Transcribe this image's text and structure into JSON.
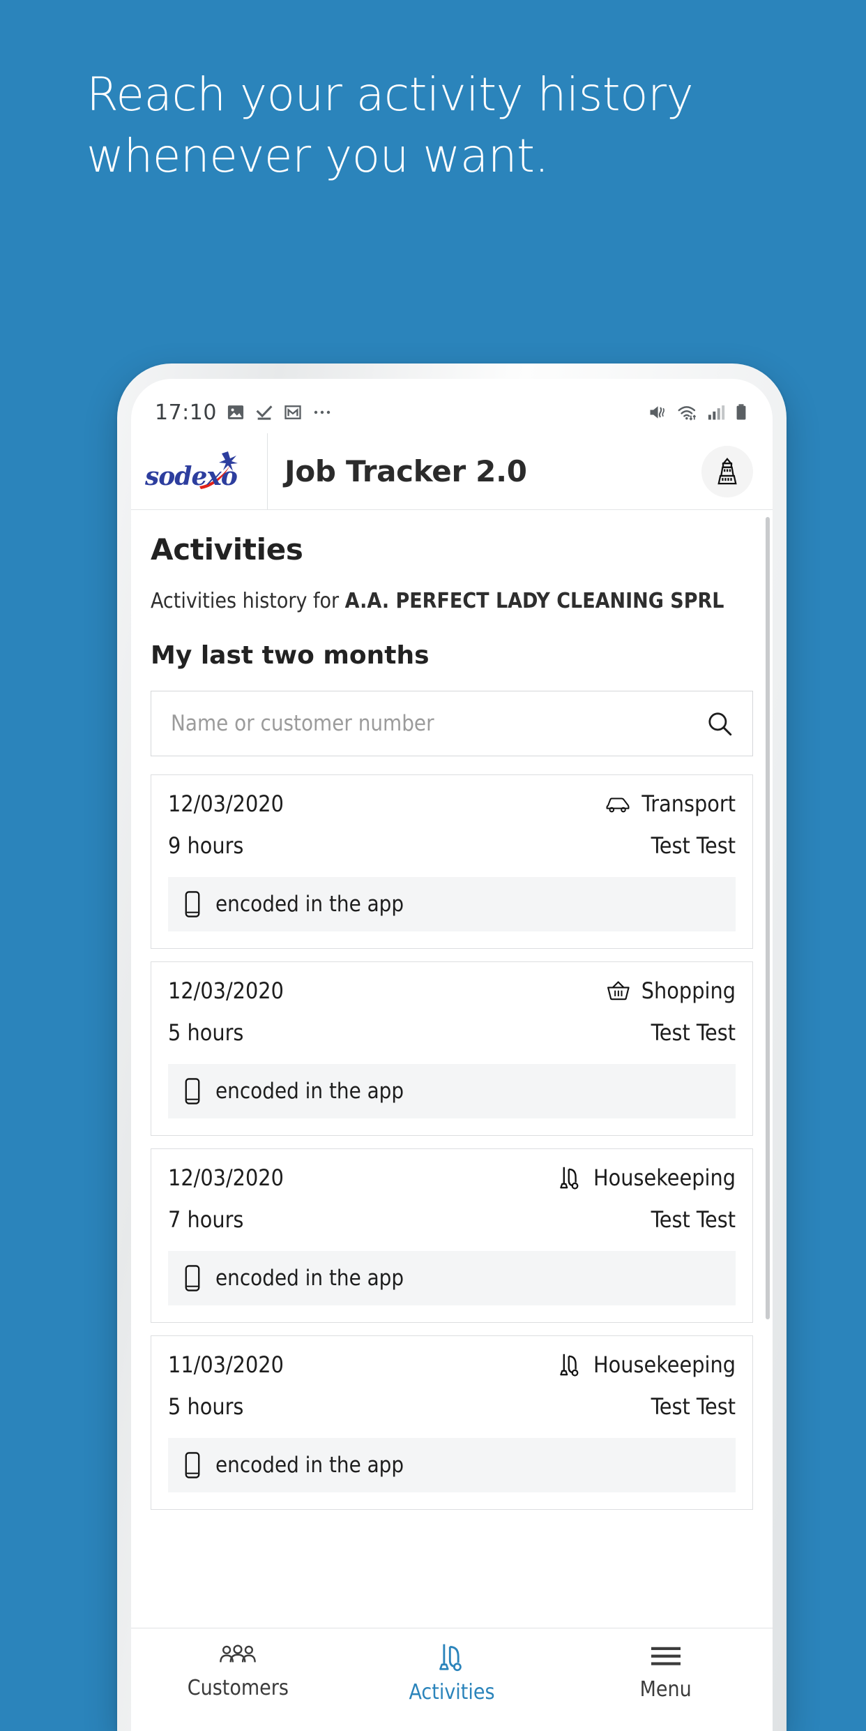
{
  "hero": {
    "line1": "Reach your activity history",
    "line2": "whenever you want."
  },
  "colors": {
    "background": "#2b84bb",
    "accent": "#2b84bb",
    "logo_blue": "#2d3e9e",
    "logo_red": "#e2231a",
    "text": "#1d1d1d"
  },
  "status_bar": {
    "time": "17:10",
    "left_icons": [
      "image-icon",
      "download-done-icon",
      "gmail-icon",
      "more-dots-icon"
    ],
    "right_icons": [
      "vibrate-mute-icon",
      "wifi-icon",
      "signal-icon",
      "battery-icon"
    ]
  },
  "app_bar": {
    "logo": "sodexo",
    "title": "Job Tracker 2.0",
    "company_icon": "company-building-icon"
  },
  "main": {
    "page_title": "Activities",
    "subtitle_prefix": "Activities history for ",
    "subtitle_company": "A.A. PERFECT LADY CLEANING SPRL",
    "section_title": "My last two months",
    "search": {
      "value": "",
      "placeholder": "Name or customer number",
      "icon": "search-icon"
    },
    "cards": [
      {
        "date": "12/03/2020",
        "type": "Transport",
        "type_icon": "car-icon",
        "hours": "9 hours",
        "worker": "Test Test",
        "note": "encoded in the app",
        "note_icon": "mobile-phone-icon"
      },
      {
        "date": "12/03/2020",
        "type": "Shopping",
        "type_icon": "basket-icon",
        "hours": "5 hours",
        "worker": "Test Test",
        "note": "encoded in the app",
        "note_icon": "mobile-phone-icon"
      },
      {
        "date": "12/03/2020",
        "type": "Housekeeping",
        "type_icon": "vacuum-icon",
        "hours": "7 hours",
        "worker": "Test Test",
        "note": "encoded in the app",
        "note_icon": "mobile-phone-icon"
      },
      {
        "date": "11/03/2020",
        "type": "Housekeeping",
        "type_icon": "vacuum-icon",
        "hours": "5 hours",
        "worker": "Test Test",
        "note": "encoded in the app",
        "note_icon": "mobile-phone-icon"
      }
    ]
  },
  "bottom_nav": {
    "items": [
      {
        "label": "Customers",
        "icon": "people-icon",
        "active": false
      },
      {
        "label": "Activities",
        "icon": "vacuum-icon",
        "active": true
      },
      {
        "label": "Menu",
        "icon": "hamburger-icon",
        "active": false
      }
    ]
  }
}
